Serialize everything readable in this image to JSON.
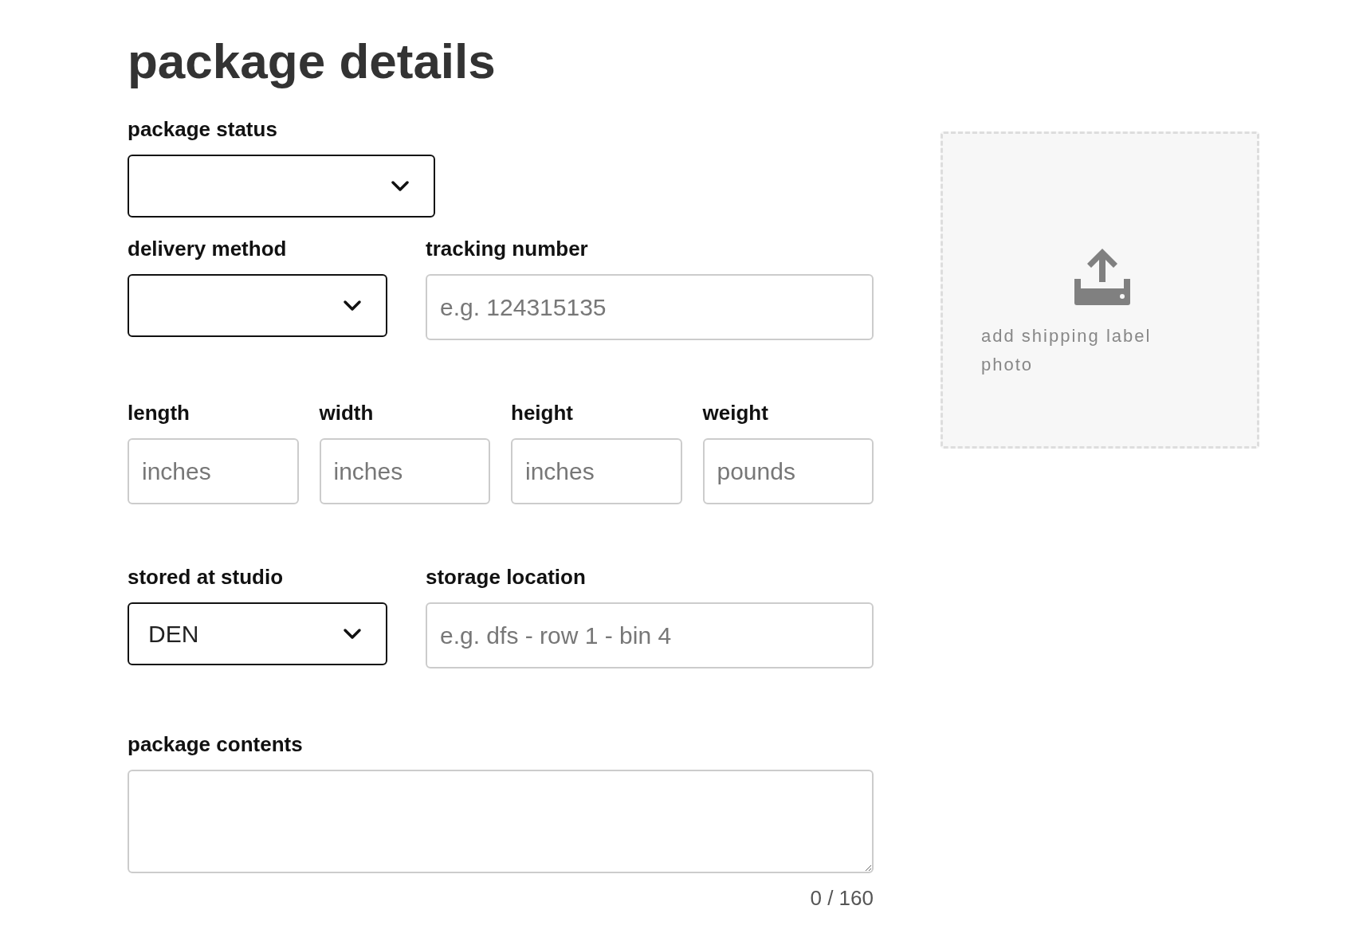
{
  "title": "package details",
  "rows": [
    [
      {
        "kind": "select",
        "label": "package status"
      }
    ],
    [
      {
        "kind": "select",
        "label": "delivery method"
      },
      {
        "kind": "input",
        "label": "tracking number",
        "placeholder": "e.g. 124315135"
      }
    ],
    [
      {
        "kind": "input",
        "label": "length",
        "placeholder": "inches"
      },
      {
        "kind": "input",
        "label": "width",
        "placeholder": "inches"
      },
      {
        "kind": "input",
        "label": "height",
        "placeholder": "inches"
      },
      {
        "kind": "input",
        "label": "weight",
        "placeholder": "pounds"
      }
    ],
    [
      {
        "kind": "select",
        "label": "stored at studio",
        "value": "DEN"
      },
      {
        "kind": "input",
        "label": "storage location",
        "placeholder": "e.g. dfs - row 1 - bin 4"
      }
    ],
    [
      {
        "kind": "textarea",
        "label": "package contents",
        "counter": "0 / 160"
      }
    ]
  ],
  "upload": {
    "label": "add shipping label photo"
  }
}
